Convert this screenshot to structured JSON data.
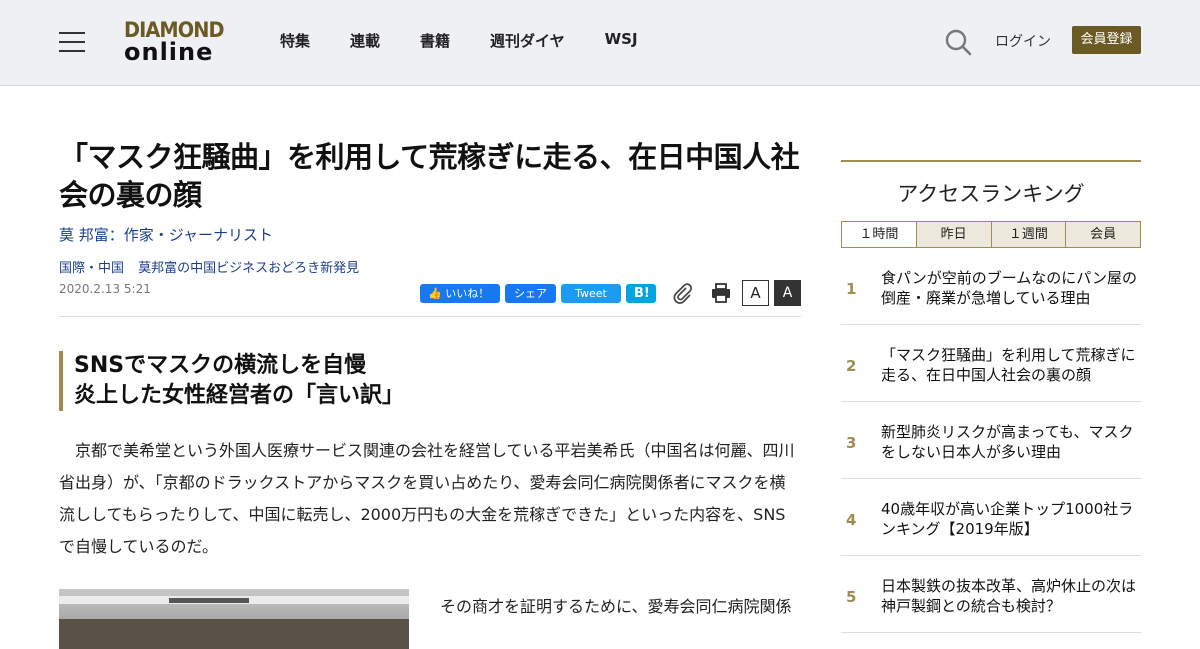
{
  "header": {
    "logo_line1": "DIAMOND",
    "logo_line2": "online",
    "nav": [
      "特集",
      "連載",
      "書籍",
      "週刊ダイヤ",
      "WSJ"
    ],
    "login_label": "ログイン",
    "register_label": "会員登録",
    "accent_color": "#6b5a24"
  },
  "article": {
    "title": "「マスク狂騒曲」を利用して荒稼ぎに走る、在日中国人社会の裏の顔",
    "author": "莫 邦富：作家・ジャーナリスト",
    "categories": [
      "国際・中国",
      "莫邦富の中国ビジネスおどろき新発見"
    ],
    "date": "2020.2.13 5:21",
    "share": {
      "like_label": "いいね！",
      "share_label": "シェア",
      "tweet_label": "Tweet",
      "hatena_label": "B!"
    },
    "font_small_label": "A",
    "font_large_label": "A",
    "subheading_line1": "SNSでマスクの横流しを自慢",
    "subheading_line2": "炎上した女性経営者の「言い訳」",
    "paragraph": "京都で美希堂という外国人医療サービス関連の会社を経営している平岩美希氏（中国名は何麗、四川省出身）が、「京都のドラックストアからマスクを買い占めたり、愛寿会同仁病院関係者にマスクを横流ししてもらったりして、中国に転売し、2000万円もの大金を荒稼ぎできた」といった内容を、SNSで自慢しているのだ。",
    "paragraph2_start": "その商才を証明するために、愛寿会同仁病院関係"
  },
  "ranking": {
    "title": "アクセスランキング",
    "tabs": [
      "１時間",
      "昨日",
      "１週間",
      "会員"
    ],
    "items": [
      {
        "rank": "1",
        "text": "食パンが空前のブームなのにパン屋の倒産・廃業が急増している理由"
      },
      {
        "rank": "2",
        "text": "「マスク狂騒曲」を利用して荒稼ぎに走る、在日中国人社会の裏の顔"
      },
      {
        "rank": "3",
        "text": "新型肺炎リスクが高まっても、マスクをしない日本人が多い理由"
      },
      {
        "rank": "4",
        "text": "40歳年収が高い企業トップ1000社ランキング【2019年版】"
      },
      {
        "rank": "5",
        "text": "日本製鉄の抜本改革、高炉休止の次は神戸製鋼との統合も検討？"
      }
    ]
  }
}
